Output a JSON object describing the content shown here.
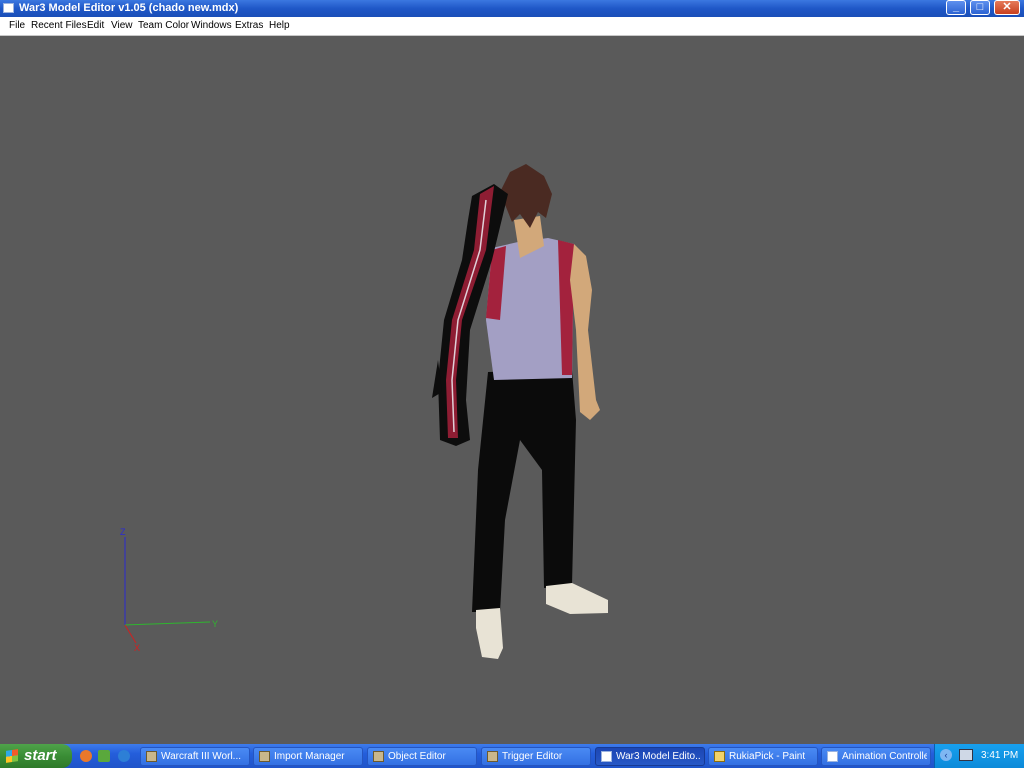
{
  "window": {
    "title": "War3 Model Editor v1.05 (chado new.mdx)",
    "minimize": "_",
    "maximize": "□",
    "close": "✕"
  },
  "menu": [
    "File",
    "Recent Files",
    "Edit",
    "View",
    "Team Color",
    "Windows",
    "Extras",
    "Help"
  ],
  "viewport": {
    "background": "#5a5a5a",
    "axes": {
      "z": "Z",
      "y": "Y",
      "x": "X",
      "z_color": "#2b2bd0",
      "y_color": "#2fb52f",
      "x_color": "#d02020"
    }
  },
  "taskbar": {
    "start": "start",
    "tasks": [
      {
        "label": "Warcraft III Worl...",
        "icon": "warcraft-icon"
      },
      {
        "label": "Import Manager",
        "icon": "warcraft-icon"
      },
      {
        "label": "Object Editor",
        "icon": "warcraft-icon"
      },
      {
        "label": "Trigger Editor",
        "icon": "warcraft-icon"
      },
      {
        "label": "War3 Model Edito...",
        "icon": "window-icon",
        "active": true
      },
      {
        "label": "RukiaPick - Paint",
        "icon": "paint-icon"
      },
      {
        "label": "Animation Controller",
        "icon": "window-icon"
      }
    ],
    "clock": "3:41 PM"
  }
}
